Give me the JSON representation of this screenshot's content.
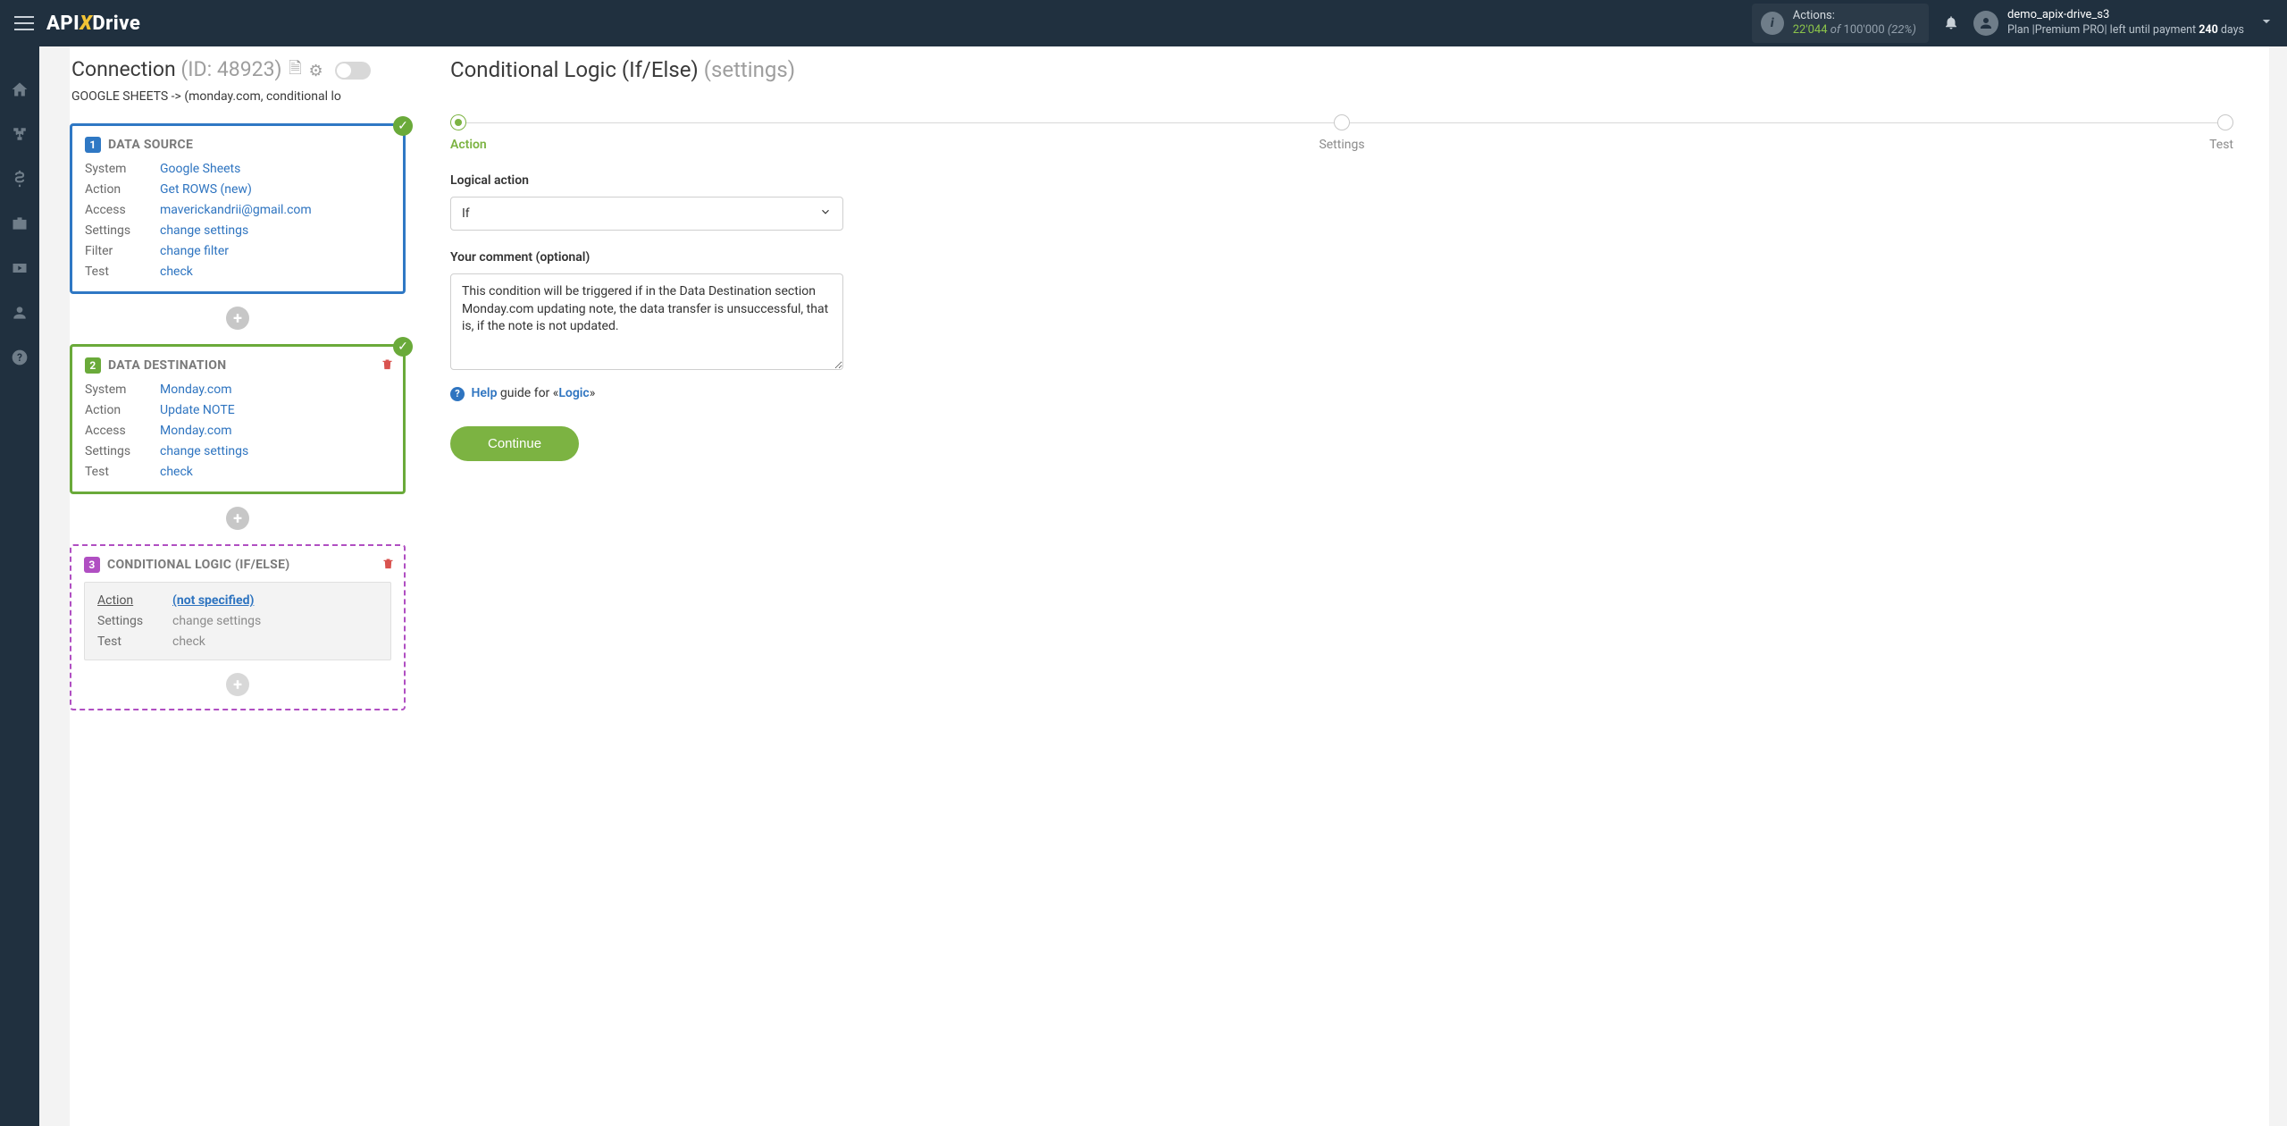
{
  "topbar": {
    "logo_api": "API",
    "logo_x": "X",
    "logo_drive": "Drive",
    "actions": {
      "label": "Actions:",
      "count": "22'044",
      "of": " of ",
      "limit": "100'000",
      "pct": " (22%)"
    },
    "user": {
      "name": "demo_apix-drive_s3",
      "plan_prefix": "Plan |",
      "plan_name": "Premium PRO",
      "plan_mid": "| left until payment ",
      "days_num": "240",
      "days_word": " days"
    }
  },
  "connection": {
    "title": "Connection ",
    "id_text": "(ID: 48923)",
    "path": "GOOGLE SHEETS -> (monday.com, conditional lo"
  },
  "block1": {
    "title": "DATA SOURCE",
    "num": "1",
    "rows": {
      "system_k": "System",
      "system_v": "Google Sheets",
      "action_k": "Action",
      "action_v": "Get ROWS (new)",
      "access_k": "Access",
      "access_v": "maverickandrii@gmail.com",
      "settings_k": "Settings",
      "settings_v": "change settings",
      "filter_k": "Filter",
      "filter_v": "change filter",
      "test_k": "Test",
      "test_v": "check"
    }
  },
  "block2": {
    "title": "DATA DESTINATION",
    "num": "2",
    "rows": {
      "system_k": "System",
      "system_v": "Monday.com",
      "action_k": "Action",
      "action_v": "Update NOTE",
      "access_k": "Access",
      "access_v": "Monday.com",
      "settings_k": "Settings",
      "settings_v": "change settings",
      "test_k": "Test",
      "test_v": "check"
    }
  },
  "block3": {
    "title": "CONDITIONAL LOGIC (IF/ELSE)",
    "num": "3",
    "rows": {
      "action_k": "Action",
      "action_v": "(not specified)",
      "settings_k": "Settings",
      "settings_v": "change settings",
      "test_k": "Test",
      "test_v": "check"
    }
  },
  "main": {
    "title": "Conditional Logic (If/Else) ",
    "title_sub": "(settings)",
    "steps": {
      "s1": "Action",
      "s2": "Settings",
      "s3": "Test"
    },
    "logical_label": "Logical action",
    "select_value": "If",
    "comment_label": "Your comment (optional)",
    "comment_value": "This condition will be triggered if in the Data Destination section Monday.com updating note, the data transfer is unsuccessful, that is, if the note is not updated.",
    "help_link": "Help",
    "help_mid": " guide for «",
    "help_logic": "Logic",
    "help_end": "»",
    "continue": "Continue"
  }
}
